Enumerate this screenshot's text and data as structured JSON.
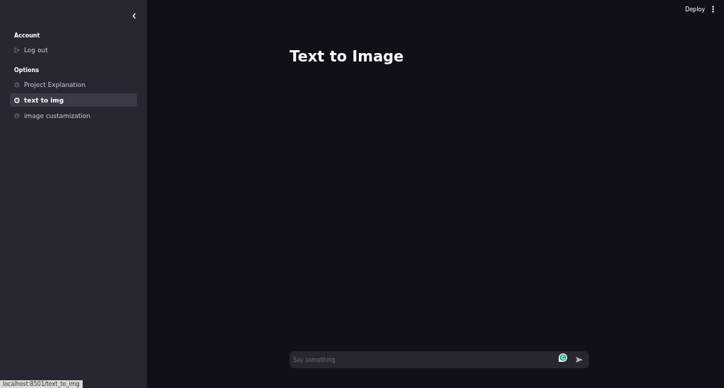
{
  "sidebar": {
    "account_heading": "Account",
    "account_items": [
      {
        "label": "Log out"
      }
    ],
    "options_heading": "Options",
    "items": [
      {
        "label": "Project Explanation",
        "selected": false
      },
      {
        "label": "text to img",
        "selected": true
      },
      {
        "label": "image custamization",
        "selected": false
      }
    ]
  },
  "toolbar": {
    "deploy": "Deploy"
  },
  "main": {
    "title": "Text to Image"
  },
  "chat_input": {
    "placeholder": "Say something"
  },
  "status_bar": {
    "url": "localhost:8501/text_to_img"
  }
}
